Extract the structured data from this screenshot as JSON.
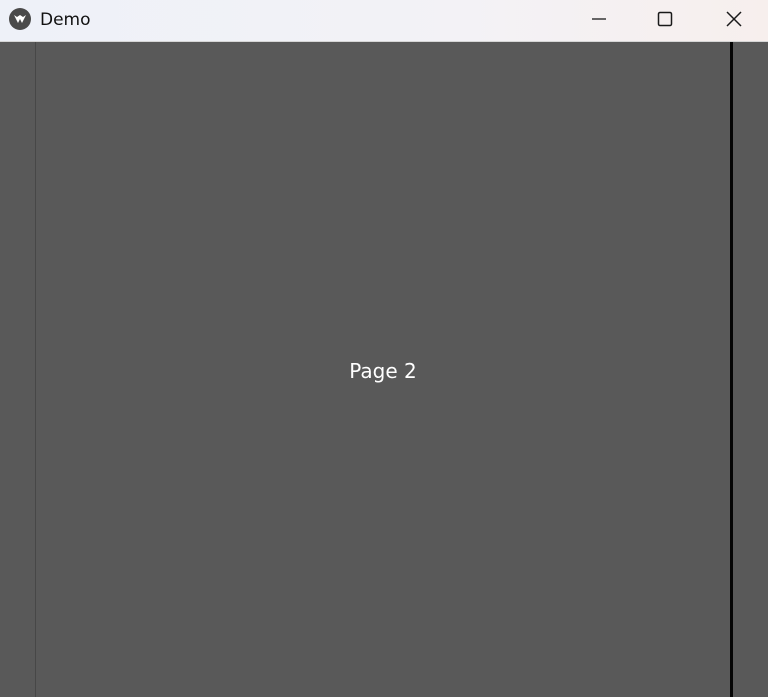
{
  "window": {
    "title": "Demo",
    "icon": "app-logo-icon",
    "controls": {
      "minimize_icon": "minimize-icon",
      "maximize_icon": "maximize-icon",
      "close_icon": "close-icon"
    }
  },
  "main": {
    "page_label": "Page 2",
    "background_color": "#595959",
    "text_color": "#ffffff"
  }
}
